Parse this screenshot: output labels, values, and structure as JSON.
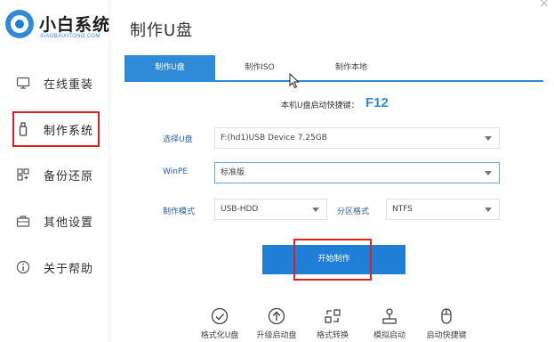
{
  "app": {
    "name": "小白系统",
    "subtitle": "XIAOBAIXITONG.COM",
    "close_glyph": "×"
  },
  "sidebar": {
    "items": [
      {
        "label": "在线重装",
        "icon": "monitor-icon"
      },
      {
        "label": "制作系统",
        "icon": "usb-drive-icon",
        "active": true
      },
      {
        "label": "备份还原",
        "icon": "grid-restore-icon"
      },
      {
        "label": "其他设置",
        "icon": "briefcase-icon"
      },
      {
        "label": "关于帮助",
        "icon": "info-icon"
      }
    ]
  },
  "page": {
    "title": "制作U盘"
  },
  "tabs": [
    {
      "label": "制作U盘",
      "active": true
    },
    {
      "label": "制作ISO",
      "active": false
    },
    {
      "label": "制作本地",
      "active": false
    }
  ],
  "form": {
    "hotkey_label": "本机U盘启动快捷键：",
    "hotkey_value": "F12",
    "usb_label": "选择U盘",
    "usb_value": "F:(hd1)USB Device 7.25GB",
    "winpe_label": "WinPE",
    "winpe_value": "标准版",
    "mode_label": "制作模式",
    "mode_value": "USB-HDD",
    "partition_label": "分区格式",
    "partition_value": "NTFS"
  },
  "actions": {
    "start_label": "开始制作"
  },
  "tools": [
    {
      "label": "格式化U盘",
      "icon": "check-circle-icon"
    },
    {
      "label": "升级启动盘",
      "icon": "upload-circle-icon"
    },
    {
      "label": "格式转换",
      "icon": "convert-icon"
    },
    {
      "label": "模拟启动",
      "icon": "joystick-icon"
    },
    {
      "label": "启动快捷键",
      "icon": "mouse-icon"
    }
  ],
  "colors": {
    "accent": "#2f8bd8",
    "button": "#1f7ed6",
    "highlight": "#e02020"
  }
}
